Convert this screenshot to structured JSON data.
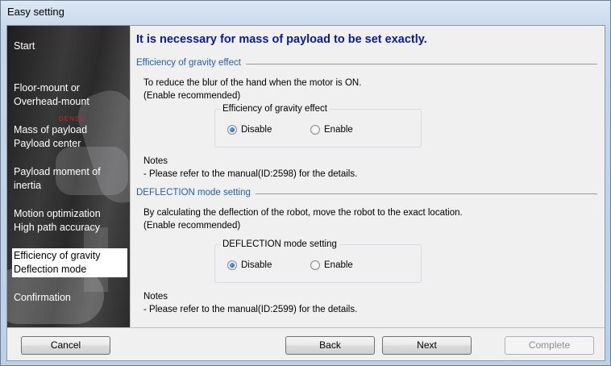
{
  "window": {
    "title": "Easy setting"
  },
  "sidebar": {
    "logo_text": "DENSO",
    "items": [
      {
        "line1": "Start",
        "line2": "",
        "active": false
      },
      {
        "line1": "Floor-mount or",
        "line2": "Overhead-mount",
        "active": false
      },
      {
        "line1": "Mass of payload",
        "line2": "Payload center",
        "active": false
      },
      {
        "line1": "Payload moment of",
        "line2": "inertia",
        "active": false
      },
      {
        "line1": "Motion optimization",
        "line2": "High path accuracy",
        "active": false
      },
      {
        "line1": "Efficiency of gravity",
        "line2": "Deflection mode",
        "active": true
      },
      {
        "line1": "Confirmation",
        "line2": "",
        "active": false
      }
    ]
  },
  "main": {
    "heading": "It is necessary for mass of payload to be set exactly.",
    "gravity": {
      "section_title": "Efficiency of gravity effect",
      "desc_line1": "To reduce the blur of the hand when the motor is ON.",
      "desc_line2": "(Enable recommended)",
      "group_label": "Efficiency of gravity effect",
      "option_disable": "Disable",
      "option_enable": "Enable",
      "selected": "Disable",
      "notes_title": "Notes",
      "notes_text": "- Please refer to the manual(ID:2598) for the details."
    },
    "deflection": {
      "section_title": "DEFLECTION mode setting",
      "desc_line1": "By calculating the deflection of the robot, move the robot to the exact location.",
      "desc_line2": "(Enable recommended)",
      "group_label": "DEFLECTION mode setting",
      "option_disable": "Disable",
      "option_enable": "Enable",
      "selected": "Disable",
      "notes_title": "Notes",
      "notes_text": "- Please refer to the manual(ID:2599) for the details."
    }
  },
  "buttons": {
    "cancel": "Cancel",
    "back": "Back",
    "next": "Next",
    "complete": "Complete",
    "complete_enabled": false
  },
  "colors": {
    "heading": "#0a1aa0",
    "section_title": "#1f5fb3",
    "sidebar_bg": "#2a2a2a",
    "active_nav_bg": "#ffffff"
  }
}
